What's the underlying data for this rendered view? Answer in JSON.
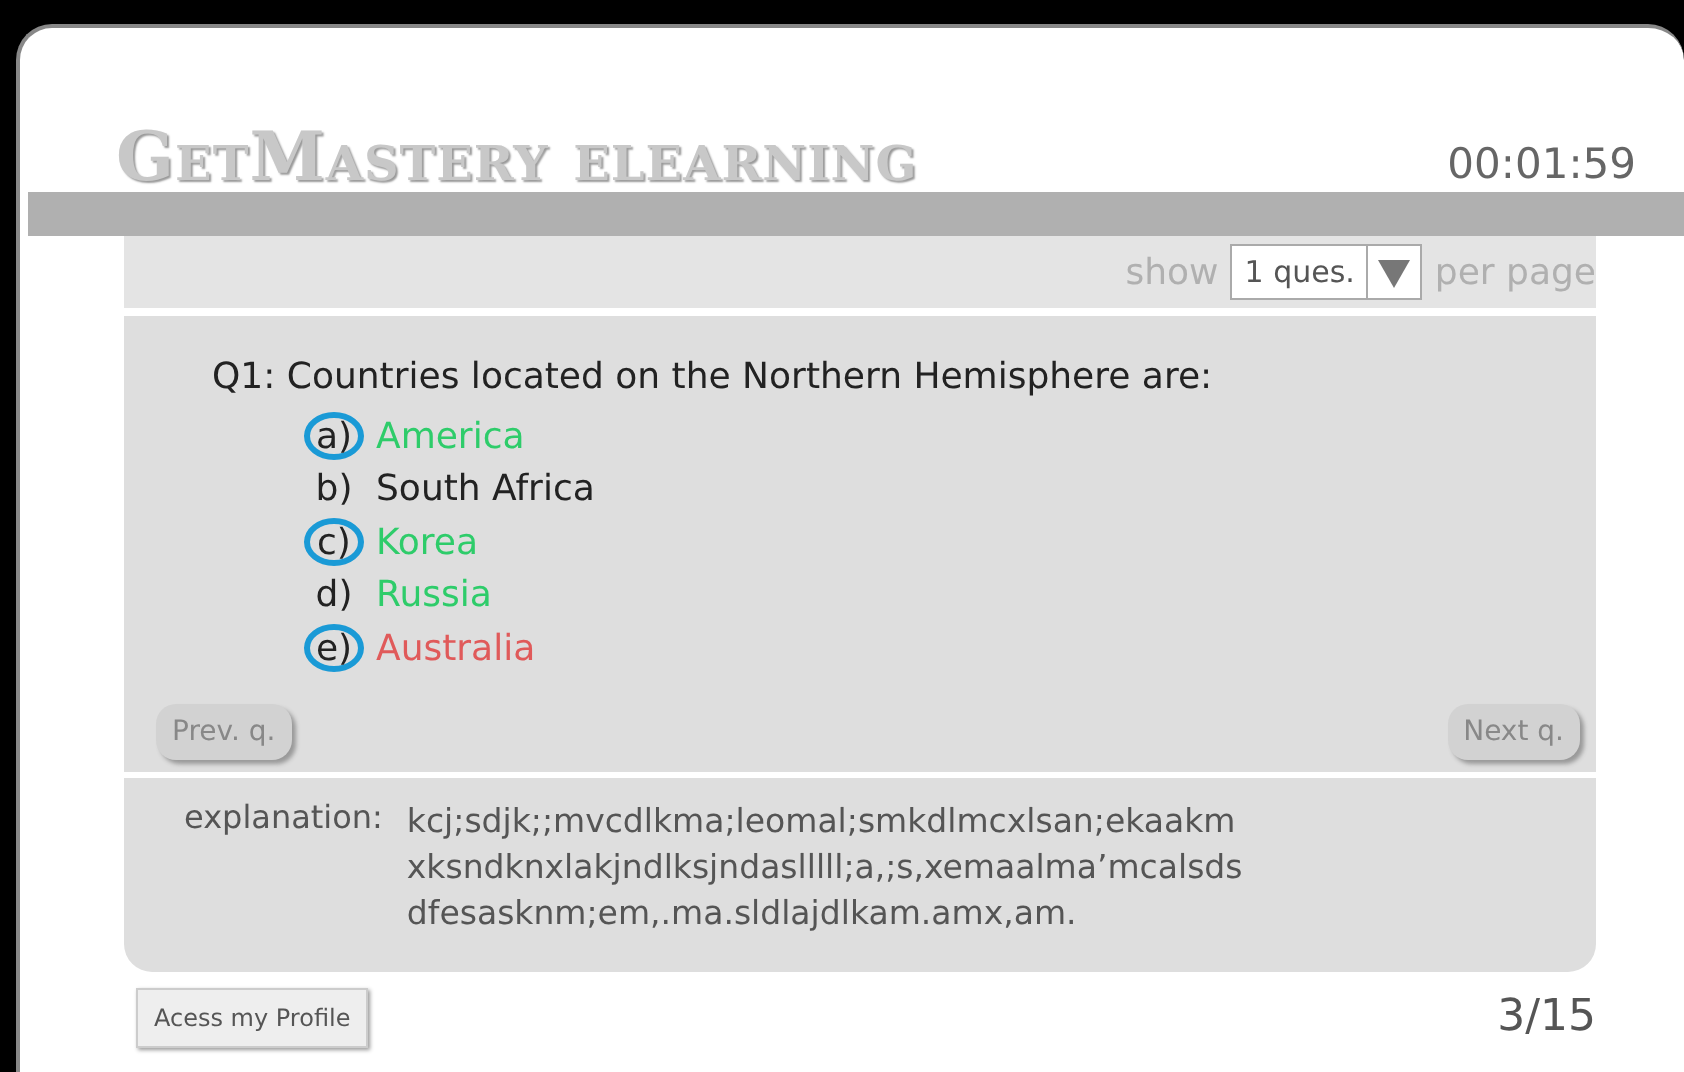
{
  "header": {
    "logo": "GetMastery elearning",
    "timer": "00:01:59"
  },
  "paging": {
    "prefix": "show",
    "value": "1 ques.",
    "suffix": "per page"
  },
  "question": {
    "text": "Q1: Countries located on the Northern Hemisphere are:",
    "options": [
      {
        "letter": "a)",
        "label": "America",
        "selected": true,
        "color": "#2ecc6a"
      },
      {
        "letter": "b)",
        "label": "South Africa",
        "selected": false,
        "color": "#222222"
      },
      {
        "letter": "c)",
        "label": "Korea",
        "selected": true,
        "color": "#2ecc6a"
      },
      {
        "letter": "d)",
        "label": "Russia",
        "selected": false,
        "color": "#2ecc6a"
      },
      {
        "letter": "e)",
        "label": "Australia",
        "selected": true,
        "color": "#e05a5a"
      }
    ]
  },
  "nav": {
    "prev": "Prev. q.",
    "next": "Next q."
  },
  "explanation": {
    "label": "explanation:",
    "text": "kcj;sdjk;;mvcdlkma;leomal;smkdlmcxlsan;ekaakm xksndknxlakjndlksjndaslllll;a,;s,xemaalma’mcalsds dfesasknm;em,.ma.sldlajdlkam.amx,am."
  },
  "footer": {
    "profile_button": "Acess my Profile",
    "progress": "3/15"
  }
}
